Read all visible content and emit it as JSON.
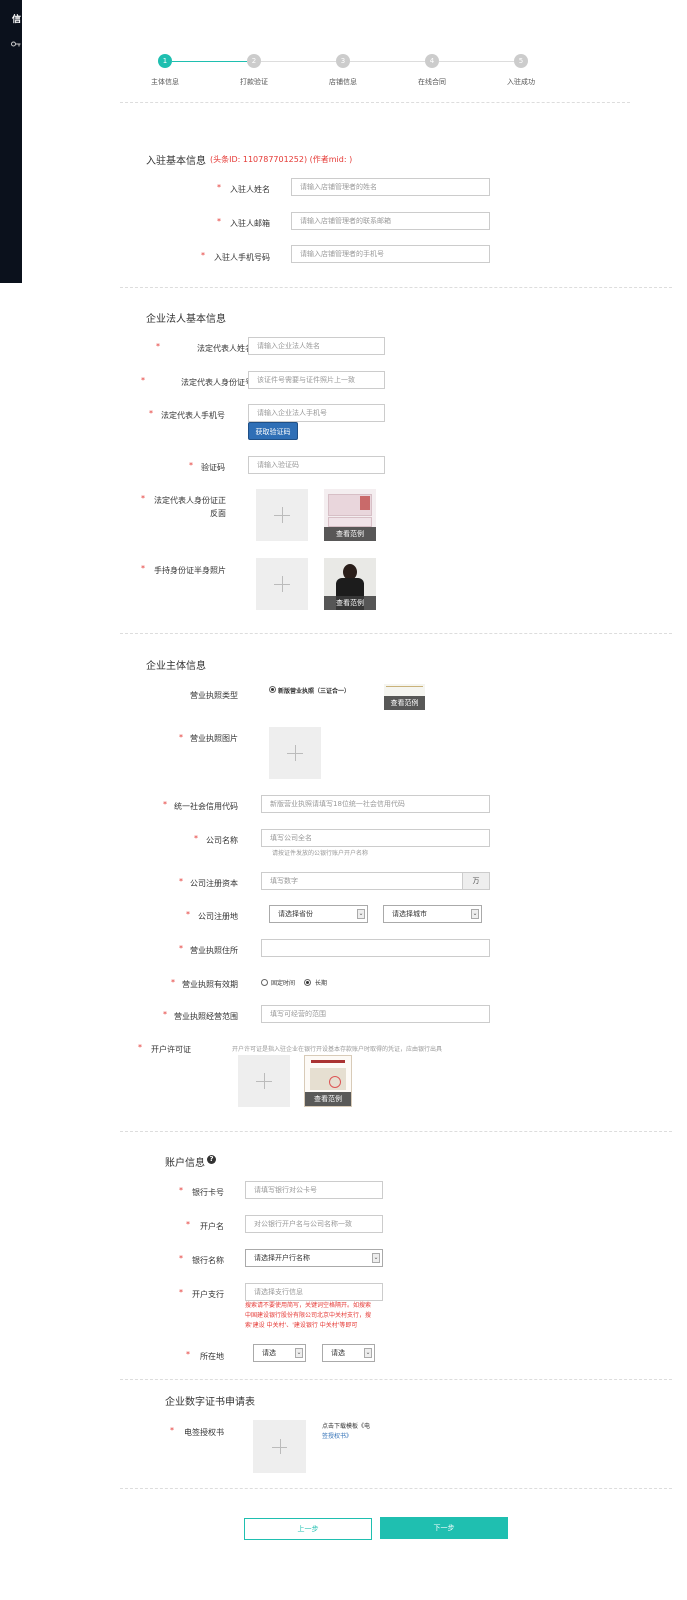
{
  "sidebar": {
    "logo": "信",
    "key_icon": "key-icon"
  },
  "steps": [
    {
      "num": "1",
      "label": "主体信息"
    },
    {
      "num": "2",
      "label": "打款验证"
    },
    {
      "num": "3",
      "label": "店铺信息"
    },
    {
      "num": "4",
      "label": "在线合同"
    },
    {
      "num": "5",
      "label": "入驻成功"
    }
  ],
  "basic": {
    "title": "入驻基本信息",
    "subtitle": "(头条ID: 110787701252) (作者mid: )",
    "fields": [
      {
        "label": "入驻人姓名",
        "placeholder": "请输入店铺管理者的姓名"
      },
      {
        "label": "入驻人邮箱",
        "placeholder": "请输入店铺管理者的联系邮箱"
      },
      {
        "label": "入驻人手机号码",
        "placeholder": "请输入店铺管理者的手机号"
      }
    ]
  },
  "legal": {
    "title": "企业法人基本信息",
    "name_label": "法定代表人姓名",
    "name_placeholder": "请输入企业法人姓名",
    "id_label": "法定代表人身份证号",
    "id_placeholder": "该证件号需要与证件照片上一致",
    "phone_label": "法定代表人手机号",
    "phone_placeholder": "请输入企业法人手机号",
    "get_code": "获取验证码",
    "code_label": "验证码",
    "code_placeholder": "请输入验证码",
    "idphoto_label_1": "法定代表人身份证正",
    "idphoto_label_2": "反面",
    "handheld_label": "手持身份证半身照片",
    "example": "查看范例"
  },
  "company": {
    "title": "企业主体信息",
    "license_type_label": "营业执照类型",
    "license_type_value": "新版营业执照（三证合一）",
    "license_img_label": "营业执照图片",
    "credit_label": "统一社会信用代码",
    "credit_placeholder": "新版营业执照请填写18位统一社会信用代码",
    "name_label": "公司名称",
    "name_placeholder": "填写公司全名",
    "name_hint": "请按证件发放的公银行账户开户名称",
    "capital_label": "公司注册资本",
    "capital_placeholder": "填写数字",
    "capital_unit": "万",
    "location_label": "公司注册地",
    "province": "请选择省份",
    "city": "请选择城市",
    "address_label": "营业执照住所",
    "validity_label": "营业执照有效期",
    "validity_fixed": "固定时间",
    "validity_long": "长期",
    "scope_label": "营业执照经营范围",
    "scope_placeholder": "填写可经营的范围",
    "permit_label": "开户许可证",
    "permit_hint": "开户许可证是指入驻企业在银行开设基本存款账户时取得的凭证，应由银行出具",
    "example": "查看范例"
  },
  "account": {
    "title": "账户信息",
    "help_icon": "help-icon",
    "card_label": "银行卡号",
    "card_placeholder": "请填写银行对公卡号",
    "holder_label": "开户名",
    "holder_placeholder": "对公银行开户名与公司名称一致",
    "bank_label": "银行名称",
    "bank_value": "请选择开户行名称",
    "branch_label": "开户支行",
    "branch_placeholder": "请选择支行信息",
    "branch_hint_1": "搜索请不要使用简写，关键词空格隔开。如搜索",
    "branch_hint_2": "中国建设银行股份有限公司北京中关村支行，搜",
    "branch_hint_3": "索'建设 中关村'、'建设银行 中关村'等即可",
    "loc_label": "所在地",
    "loc_1": "请选",
    "loc_2": "请选"
  },
  "cert": {
    "title": "企业数字证书申请表",
    "auth_label": "电签授权书",
    "download_1": "点击下载模板《电",
    "download_2": "签授权书》"
  },
  "footer": {
    "prev": "上一步",
    "next": "下一步"
  },
  "colors": {
    "accent": "#1fbfb0",
    "required": "#e53935",
    "code_button": "#2f6fb6"
  }
}
